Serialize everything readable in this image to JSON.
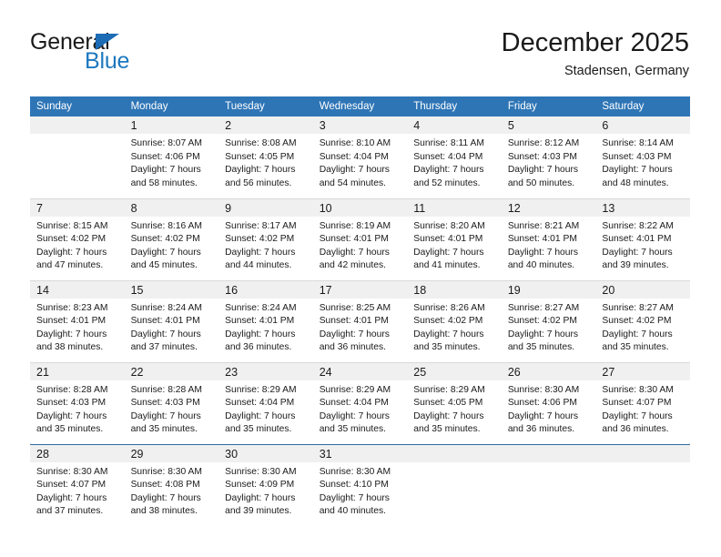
{
  "logo": {
    "word1": "General",
    "word2": "Blue",
    "triangle_color": "#1c6cb5"
  },
  "header": {
    "title": "December 2025",
    "location": "Stadensen, Germany"
  },
  "theme": {
    "header_blue": "#2e75b6",
    "daynum_band": "#f0f0f0",
    "row_separator": "#d9d9d9",
    "blue_separator": "#2e6da4",
    "text": "#1a1a1a"
  },
  "weekdays": [
    "Sunday",
    "Monday",
    "Tuesday",
    "Wednesday",
    "Thursday",
    "Friday",
    "Saturday"
  ],
  "labels": {
    "sunrise_prefix": "Sunrise:",
    "sunset_prefix": "Sunset:",
    "daylight_prefix": "Daylight:"
  },
  "weeks": [
    [
      {
        "day": "",
        "empty": true
      },
      {
        "day": "1",
        "sunrise": "Sunrise: 8:07 AM",
        "sunset": "Sunset: 4:06 PM",
        "daylight1": "Daylight: 7 hours",
        "daylight2": "and 58 minutes."
      },
      {
        "day": "2",
        "sunrise": "Sunrise: 8:08 AM",
        "sunset": "Sunset: 4:05 PM",
        "daylight1": "Daylight: 7 hours",
        "daylight2": "and 56 minutes."
      },
      {
        "day": "3",
        "sunrise": "Sunrise: 8:10 AM",
        "sunset": "Sunset: 4:04 PM",
        "daylight1": "Daylight: 7 hours",
        "daylight2": "and 54 minutes."
      },
      {
        "day": "4",
        "sunrise": "Sunrise: 8:11 AM",
        "sunset": "Sunset: 4:04 PM",
        "daylight1": "Daylight: 7 hours",
        "daylight2": "and 52 minutes."
      },
      {
        "day": "5",
        "sunrise": "Sunrise: 8:12 AM",
        "sunset": "Sunset: 4:03 PM",
        "daylight1": "Daylight: 7 hours",
        "daylight2": "and 50 minutes."
      },
      {
        "day": "6",
        "sunrise": "Sunrise: 8:14 AM",
        "sunset": "Sunset: 4:03 PM",
        "daylight1": "Daylight: 7 hours",
        "daylight2": "and 48 minutes."
      }
    ],
    [
      {
        "day": "7",
        "sunrise": "Sunrise: 8:15 AM",
        "sunset": "Sunset: 4:02 PM",
        "daylight1": "Daylight: 7 hours",
        "daylight2": "and 47 minutes."
      },
      {
        "day": "8",
        "sunrise": "Sunrise: 8:16 AM",
        "sunset": "Sunset: 4:02 PM",
        "daylight1": "Daylight: 7 hours",
        "daylight2": "and 45 minutes."
      },
      {
        "day": "9",
        "sunrise": "Sunrise: 8:17 AM",
        "sunset": "Sunset: 4:02 PM",
        "daylight1": "Daylight: 7 hours",
        "daylight2": "and 44 minutes."
      },
      {
        "day": "10",
        "sunrise": "Sunrise: 8:19 AM",
        "sunset": "Sunset: 4:01 PM",
        "daylight1": "Daylight: 7 hours",
        "daylight2": "and 42 minutes."
      },
      {
        "day": "11",
        "sunrise": "Sunrise: 8:20 AM",
        "sunset": "Sunset: 4:01 PM",
        "daylight1": "Daylight: 7 hours",
        "daylight2": "and 41 minutes."
      },
      {
        "day": "12",
        "sunrise": "Sunrise: 8:21 AM",
        "sunset": "Sunset: 4:01 PM",
        "daylight1": "Daylight: 7 hours",
        "daylight2": "and 40 minutes."
      },
      {
        "day": "13",
        "sunrise": "Sunrise: 8:22 AM",
        "sunset": "Sunset: 4:01 PM",
        "daylight1": "Daylight: 7 hours",
        "daylight2": "and 39 minutes."
      }
    ],
    [
      {
        "day": "14",
        "sunrise": "Sunrise: 8:23 AM",
        "sunset": "Sunset: 4:01 PM",
        "daylight1": "Daylight: 7 hours",
        "daylight2": "and 38 minutes."
      },
      {
        "day": "15",
        "sunrise": "Sunrise: 8:24 AM",
        "sunset": "Sunset: 4:01 PM",
        "daylight1": "Daylight: 7 hours",
        "daylight2": "and 37 minutes."
      },
      {
        "day": "16",
        "sunrise": "Sunrise: 8:24 AM",
        "sunset": "Sunset: 4:01 PM",
        "daylight1": "Daylight: 7 hours",
        "daylight2": "and 36 minutes."
      },
      {
        "day": "17",
        "sunrise": "Sunrise: 8:25 AM",
        "sunset": "Sunset: 4:01 PM",
        "daylight1": "Daylight: 7 hours",
        "daylight2": "and 36 minutes."
      },
      {
        "day": "18",
        "sunrise": "Sunrise: 8:26 AM",
        "sunset": "Sunset: 4:02 PM",
        "daylight1": "Daylight: 7 hours",
        "daylight2": "and 35 minutes."
      },
      {
        "day": "19",
        "sunrise": "Sunrise: 8:27 AM",
        "sunset": "Sunset: 4:02 PM",
        "daylight1": "Daylight: 7 hours",
        "daylight2": "and 35 minutes."
      },
      {
        "day": "20",
        "sunrise": "Sunrise: 8:27 AM",
        "sunset": "Sunset: 4:02 PM",
        "daylight1": "Daylight: 7 hours",
        "daylight2": "and 35 minutes."
      }
    ],
    [
      {
        "day": "21",
        "sunrise": "Sunrise: 8:28 AM",
        "sunset": "Sunset: 4:03 PM",
        "daylight1": "Daylight: 7 hours",
        "daylight2": "and 35 minutes."
      },
      {
        "day": "22",
        "sunrise": "Sunrise: 8:28 AM",
        "sunset": "Sunset: 4:03 PM",
        "daylight1": "Daylight: 7 hours",
        "daylight2": "and 35 minutes."
      },
      {
        "day": "23",
        "sunrise": "Sunrise: 8:29 AM",
        "sunset": "Sunset: 4:04 PM",
        "daylight1": "Daylight: 7 hours",
        "daylight2": "and 35 minutes."
      },
      {
        "day": "24",
        "sunrise": "Sunrise: 8:29 AM",
        "sunset": "Sunset: 4:04 PM",
        "daylight1": "Daylight: 7 hours",
        "daylight2": "and 35 minutes."
      },
      {
        "day": "25",
        "sunrise": "Sunrise: 8:29 AM",
        "sunset": "Sunset: 4:05 PM",
        "daylight1": "Daylight: 7 hours",
        "daylight2": "and 35 minutes."
      },
      {
        "day": "26",
        "sunrise": "Sunrise: 8:30 AM",
        "sunset": "Sunset: 4:06 PM",
        "daylight1": "Daylight: 7 hours",
        "daylight2": "and 36 minutes."
      },
      {
        "day": "27",
        "sunrise": "Sunrise: 8:30 AM",
        "sunset": "Sunset: 4:07 PM",
        "daylight1": "Daylight: 7 hours",
        "daylight2": "and 36 minutes."
      }
    ],
    [
      {
        "day": "28",
        "sunrise": "Sunrise: 8:30 AM",
        "sunset": "Sunset: 4:07 PM",
        "daylight1": "Daylight: 7 hours",
        "daylight2": "and 37 minutes."
      },
      {
        "day": "29",
        "sunrise": "Sunrise: 8:30 AM",
        "sunset": "Sunset: 4:08 PM",
        "daylight1": "Daylight: 7 hours",
        "daylight2": "and 38 minutes."
      },
      {
        "day": "30",
        "sunrise": "Sunrise: 8:30 AM",
        "sunset": "Sunset: 4:09 PM",
        "daylight1": "Daylight: 7 hours",
        "daylight2": "and 39 minutes."
      },
      {
        "day": "31",
        "sunrise": "Sunrise: 8:30 AM",
        "sunset": "Sunset: 4:10 PM",
        "daylight1": "Daylight: 7 hours",
        "daylight2": "and 40 minutes."
      },
      {
        "day": "",
        "empty": true
      },
      {
        "day": "",
        "empty": true
      },
      {
        "day": "",
        "empty": true
      }
    ]
  ]
}
